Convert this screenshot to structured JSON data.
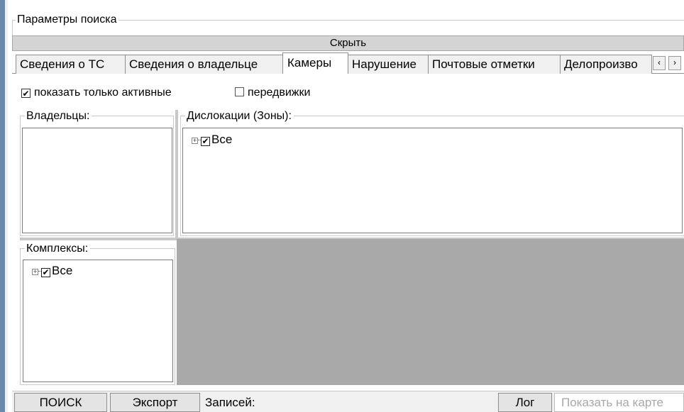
{
  "search_params": {
    "title": "Параметры поиска",
    "hide_label": "Скрыть"
  },
  "tabs": [
    {
      "label": "Сведения о ТС"
    },
    {
      "label": "Сведения о владельце"
    },
    {
      "label": "Камеры",
      "active": true
    },
    {
      "label": "Нарушение"
    },
    {
      "label": "Почтовые отметки"
    },
    {
      "label": "Делопроизво"
    }
  ],
  "tab_scroll": {
    "left": "‹",
    "right": "›"
  },
  "filters": {
    "active_only": {
      "label": "показать только активные",
      "checked": true
    },
    "mobile": {
      "label": "передвижки",
      "checked": false
    }
  },
  "owners": {
    "title": "Владельцы:"
  },
  "dislocations": {
    "title": "Дислокации (Зоны):",
    "tree_root": "Все",
    "checked": true
  },
  "complexes": {
    "title": "Комплексы:",
    "tree_root": "Все",
    "checked": true
  },
  "bottom_bar": {
    "search_label": "ПОИСК",
    "export_label": "Экспорт",
    "records_label": "Записей:",
    "log_label": "Лог",
    "show_on_map_label": "Показать на карте"
  },
  "icons": {
    "checked": "✔",
    "expand": "+"
  },
  "colors": {
    "gray_area": "#a9a9a9",
    "window_edge": "#6b88a8"
  }
}
